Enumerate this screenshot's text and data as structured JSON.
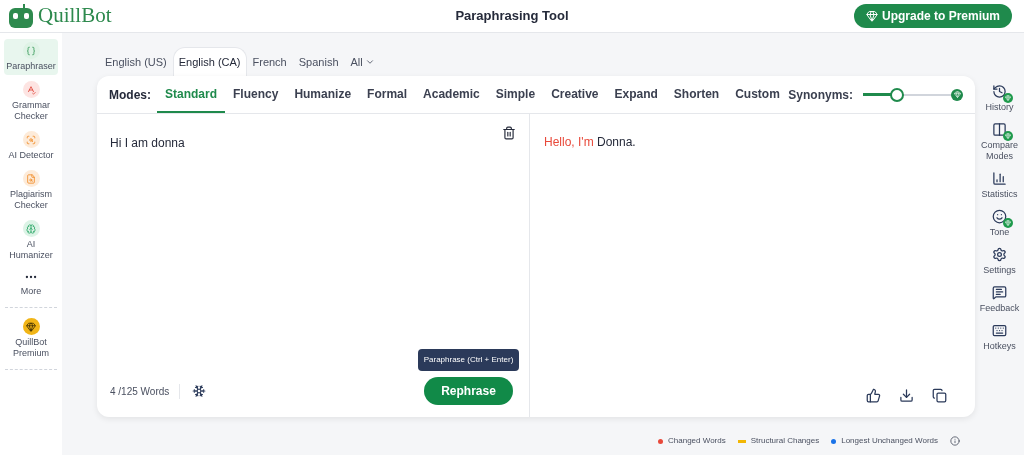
{
  "header": {
    "logo": "QuillBot",
    "title": "Paraphrasing Tool",
    "upgrade": "Upgrade to Premium"
  },
  "sidebar": {
    "items": [
      {
        "label": "Paraphraser",
        "selected": true
      },
      {
        "label": "Grammar Checker",
        "selected": false
      },
      {
        "label": "AI Detector",
        "selected": false
      },
      {
        "label": "Plagiarism Checker",
        "selected": false
      },
      {
        "label": "AI Humanizer",
        "selected": false
      },
      {
        "label": "More",
        "selected": false
      },
      {
        "label": "QuillBot Premium",
        "selected": false
      }
    ]
  },
  "languages": [
    {
      "label": "English (US)",
      "selected": false
    },
    {
      "label": "English (CA)",
      "selected": true
    },
    {
      "label": "French",
      "selected": false
    },
    {
      "label": "Spanish",
      "selected": false
    },
    {
      "label": "All",
      "selected": false,
      "dropdown": true
    }
  ],
  "modes": {
    "label": "Modes:",
    "items": [
      {
        "label": "Standard",
        "selected": true
      },
      {
        "label": "Fluency",
        "selected": false
      },
      {
        "label": "Humanize",
        "selected": false
      },
      {
        "label": "Formal",
        "selected": false
      },
      {
        "label": "Academic",
        "selected": false
      },
      {
        "label": "Simple",
        "selected": false
      },
      {
        "label": "Creative",
        "selected": false
      },
      {
        "label": "Expand",
        "selected": false
      },
      {
        "label": "Shorten",
        "selected": false
      },
      {
        "label": "Custom",
        "selected": false
      }
    ]
  },
  "synonyms": {
    "label": "Synonyms:",
    "level": 0.34
  },
  "input": {
    "text": "Hi I am donna",
    "word_count": "4 /125 Words",
    "tooltip": "Paraphrase (Ctrl + Enter)",
    "button": "Rephrase"
  },
  "output": {
    "segments": [
      {
        "text": "Hello, I'm",
        "kind": "changed"
      },
      {
        "text": "Donna.",
        "kind": "unchanged"
      }
    ]
  },
  "right_sidebar": {
    "items": [
      {
        "label": "History",
        "premium": true
      },
      {
        "label": "Compare Modes",
        "premium": true
      },
      {
        "label": "Statistics",
        "premium": false
      },
      {
        "label": "Tone",
        "premium": true
      },
      {
        "label": "Settings",
        "premium": false
      },
      {
        "label": "Feedback",
        "premium": false
      },
      {
        "label": "Hotkeys",
        "premium": false
      }
    ]
  },
  "legend": [
    {
      "label": "Changed Words",
      "color": "#e8493a",
      "kind": "dot"
    },
    {
      "label": "Structural Changes",
      "color": "#f2b705",
      "kind": "dash"
    },
    {
      "label": "Longest Unchanged Words",
      "color": "#1a73e8",
      "kind": "dot"
    }
  ]
}
